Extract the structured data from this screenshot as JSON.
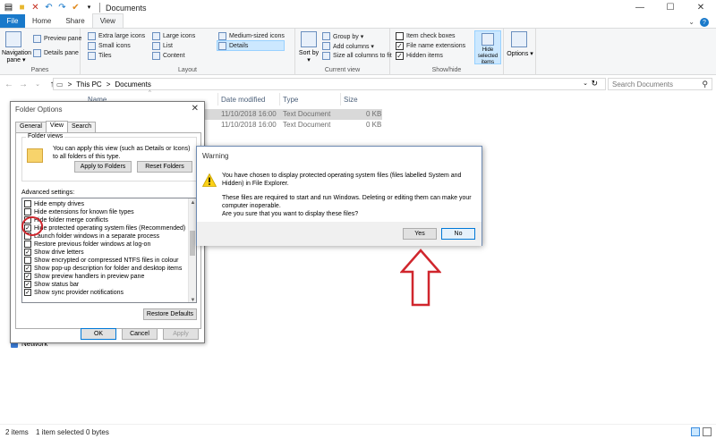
{
  "titlebar": {
    "title": "Documents",
    "controls": [
      "—",
      "☐",
      "✕"
    ]
  },
  "ribbon_tabs": [
    "File",
    "Home",
    "Share",
    "View"
  ],
  "ribbon": {
    "panes": {
      "navigation_pane": "Navigation pane ▾",
      "preview_pane": "Preview pane",
      "details_pane": "Details pane",
      "label": "Panes"
    },
    "layout": {
      "items": [
        "Extra large icons",
        "Large icons",
        "Medium-sized icons",
        "Small icons",
        "List",
        "Details",
        "Tiles",
        "Content"
      ],
      "label": "Layout"
    },
    "current_view": {
      "sort_by": "Sort by ▾",
      "group_by": "Group by ▾",
      "add_columns": "Add columns ▾",
      "size_columns": "Size all columns to fit",
      "label": "Current view"
    },
    "show_hide": {
      "item_check_boxes": "Item check boxes",
      "file_name_extensions": "File name extensions",
      "hidden_items": "Hidden items",
      "hide_selected": "Hide selected items",
      "label": "Show/hide"
    },
    "options": "Options ▾"
  },
  "address": {
    "path": [
      "This PC",
      ">",
      "Documents"
    ],
    "search_placeholder": "Search Documents"
  },
  "columns": [
    "Name",
    "Date modified",
    "Type",
    "Size"
  ],
  "files": [
    {
      "date": "11/10/2018 16:00",
      "type": "Text Document",
      "size": "0 KB"
    },
    {
      "date": "11/10/2018 16:00",
      "type": "Text Document",
      "size": "0 KB"
    }
  ],
  "nav": {
    "network": "Network"
  },
  "status": {
    "items": "2 items",
    "selected": "1 item selected  0 bytes"
  },
  "folder_options": {
    "title": "Folder Options",
    "tabs": [
      "General",
      "View",
      "Search"
    ],
    "folder_views_label": "Folder views",
    "folder_views_desc": "You can apply this view (such as Details or Icons) to all folders of this type.",
    "apply_to_folders": "Apply to Folders",
    "reset_folders": "Reset Folders",
    "advanced_label": "Advanced settings:",
    "advanced": [
      {
        "label": "Hide empty drives",
        "checked": false
      },
      {
        "label": "Hide extensions for known file types",
        "checked": false
      },
      {
        "label": "Hide folder merge conflicts",
        "checked": false
      },
      {
        "label": "Hide protected operating system files (Recommended)",
        "checked": true
      },
      {
        "label": "Launch folder windows in a separate process",
        "checked": false
      },
      {
        "label": "Restore previous folder windows at log-on",
        "checked": false
      },
      {
        "label": "Show drive letters",
        "checked": true
      },
      {
        "label": "Show encrypted or compressed NTFS files in colour",
        "checked": false
      },
      {
        "label": "Show pop-up description for folder and desktop items",
        "checked": true
      },
      {
        "label": "Show preview handlers in preview pane",
        "checked": true
      },
      {
        "label": "Show status bar",
        "checked": true
      },
      {
        "label": "Show sync provider notifications",
        "checked": true
      }
    ],
    "restore_defaults": "Restore Defaults",
    "ok": "OK",
    "cancel": "Cancel",
    "apply": "Apply"
  },
  "warning": {
    "title": "Warning",
    "line1": "You have chosen to display protected operating system files (files labelled System and Hidden) in File Explorer.",
    "line2": "These files are required to start and run Windows. Deleting or editing them can make your computer inoperable.",
    "line3": "Are you sure that you want to display these files?",
    "yes": "Yes",
    "no": "No"
  },
  "colors": {
    "accent": "#1979ca",
    "annotation": "#d0262d",
    "selection": "#cce8ff"
  }
}
